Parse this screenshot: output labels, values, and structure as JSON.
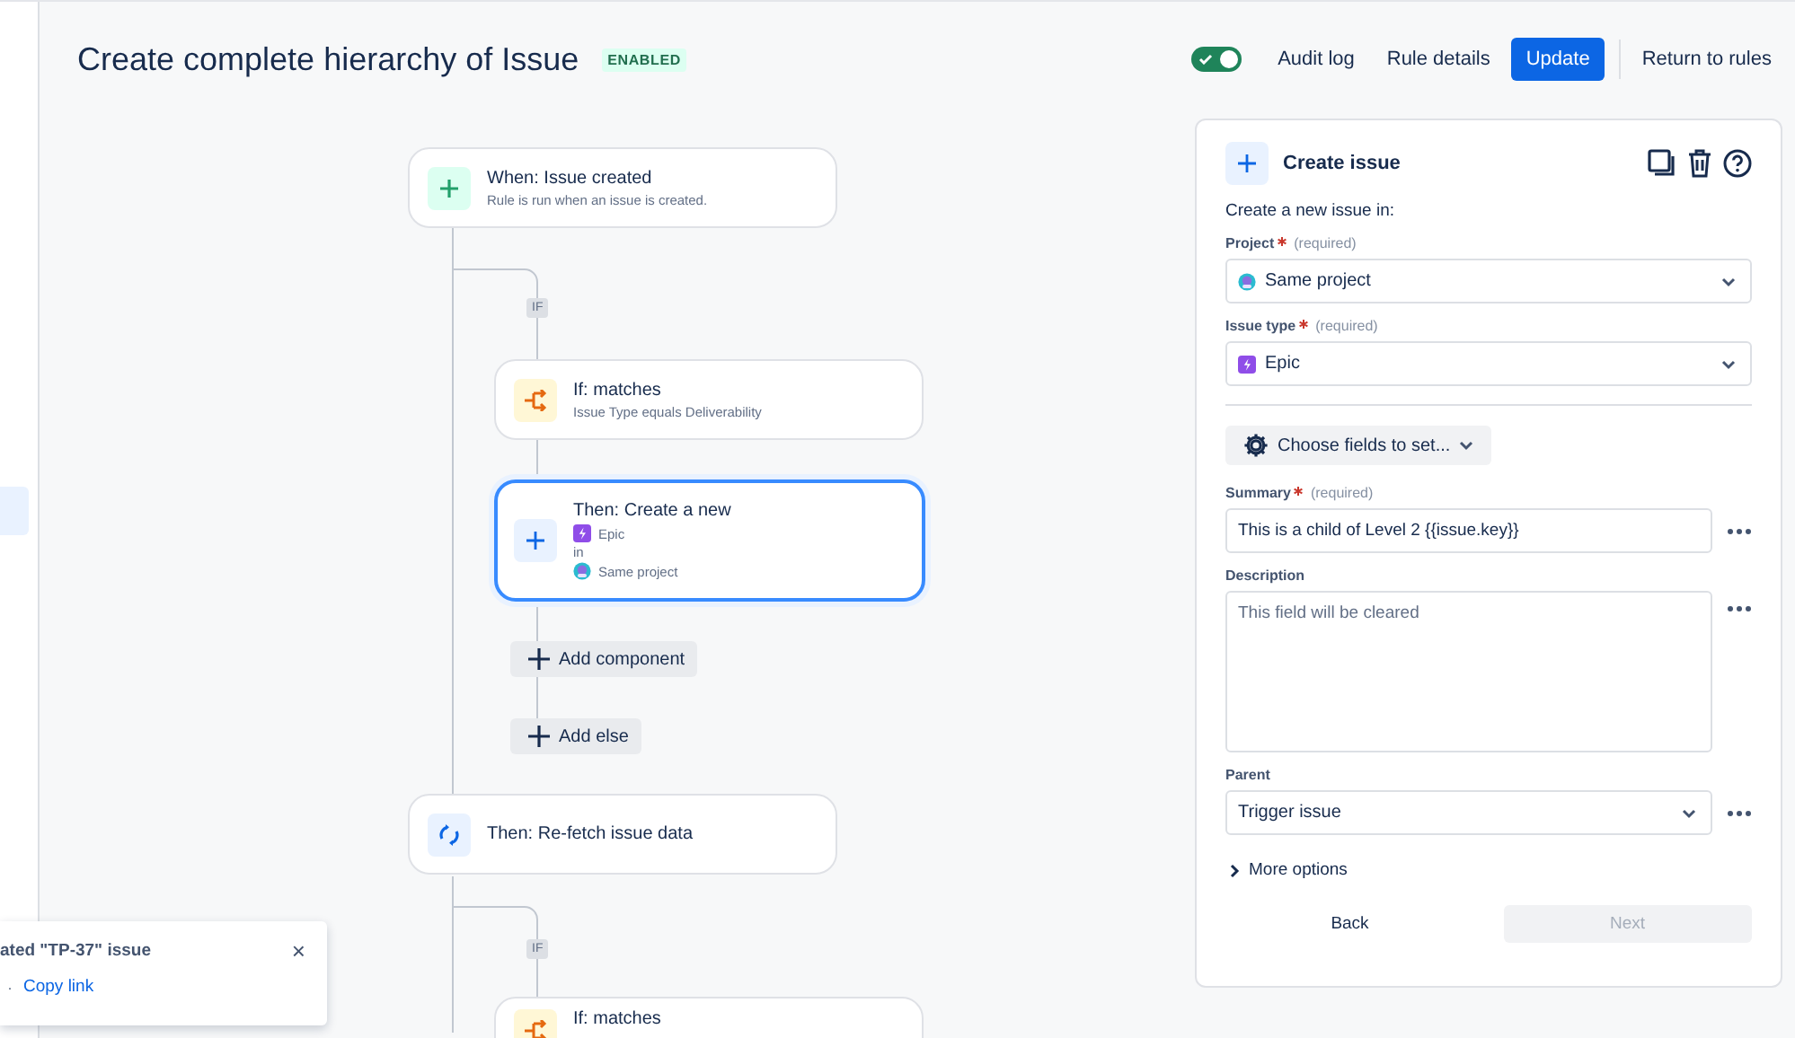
{
  "sidebar": {
    "items": [
      {
        "selected": true
      }
    ]
  },
  "header": {
    "title": "Create complete hierarchy of Issue",
    "status_badge": "ENABLED",
    "rule_enabled": true,
    "actions": [
      {
        "kind": "link",
        "label": "Audit log"
      },
      {
        "kind": "link",
        "label": "Rule details"
      },
      {
        "kind": "primary",
        "label": "Update"
      },
      {
        "kind": "divider-link",
        "label": "Return to rules"
      }
    ]
  },
  "flow": {
    "nodes": [
      {
        "kind": "trigger",
        "title": "When: Issue created",
        "subtitle": "Rule is run when an issue is created.",
        "selected": false
      },
      {
        "kind": "condition",
        "branch_label": "IF",
        "title": "If: matches",
        "subtitle": "Issue Type equals Deliverability",
        "selected": false
      },
      {
        "kind": "create",
        "title": "Then: Create a new",
        "issue_type": "Epic",
        "connector": "in",
        "project": "Same project",
        "selected": true
      },
      {
        "kind": "refetch",
        "title": "Then: Re-fetch issue data",
        "selected": false
      },
      {
        "kind": "condition",
        "branch_label": "IF",
        "title": "If: matches",
        "selected": false
      }
    ],
    "buttons": [
      "Add component",
      "Add else"
    ]
  },
  "panel": {
    "title": "Create issue",
    "intro": "Create a new issue in:",
    "fields": [
      {
        "kind": "project-select",
        "label": "Project",
        "required": "(required)",
        "value": "Same project"
      },
      {
        "kind": "type-select",
        "label": "Issue type",
        "required": "(required)",
        "value": "Epic"
      },
      {
        "kind": "menu",
        "label": "Choose fields to set..."
      },
      {
        "kind": "text",
        "label": "Summary",
        "required": "(required)",
        "value": "This is a child of Level 2 {{issue.key}}"
      },
      {
        "kind": "textarea",
        "label": "Description",
        "placeholder": "This field will be cleared"
      },
      {
        "kind": "select",
        "label": "Parent",
        "value": "Trigger issue"
      }
    ],
    "more_options": {
      "label": "More options",
      "expanded": false
    },
    "buttons": [
      {
        "label": "Back",
        "disabled": false
      },
      {
        "label": "Next",
        "disabled": true
      }
    ]
  },
  "toast": {
    "message": "ated \"TP-37\" issue",
    "link": "Copy link",
    "separator": "·",
    "close": "×"
  }
}
